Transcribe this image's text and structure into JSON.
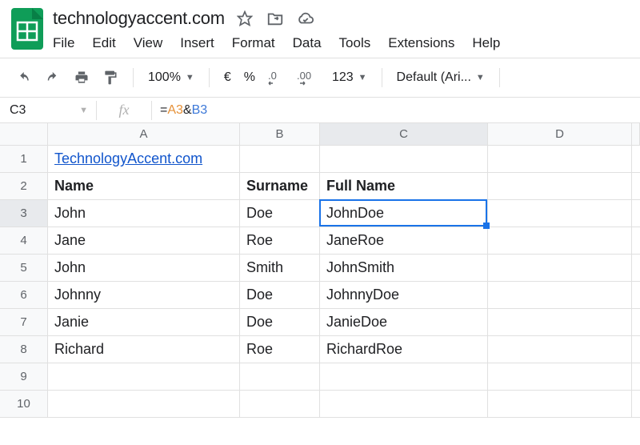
{
  "doc": {
    "title": "technologyaccent.com"
  },
  "menu": {
    "items": [
      "File",
      "Edit",
      "View",
      "Insert",
      "Format",
      "Data",
      "Tools",
      "Extensions",
      "Help"
    ]
  },
  "toolbar": {
    "zoom": "100%",
    "currency": "€",
    "percent": "%",
    "dec_dec": ".0",
    "dec_inc": ".00",
    "more_formats": "123",
    "font": "Default (Ari..."
  },
  "formula_bar": {
    "name_box": "C3",
    "formula_prefix": "=",
    "ref_a": "A3",
    "amp": "&",
    "ref_b": "B3"
  },
  "columns": [
    "A",
    "B",
    "C",
    "D",
    ""
  ],
  "rows": [
    {
      "n": "1",
      "cells": [
        "TechnologyAccent.com",
        "",
        "",
        "",
        ""
      ],
      "styles": [
        "link",
        "",
        "",
        "",
        ""
      ]
    },
    {
      "n": "2",
      "cells": [
        "Name",
        "Surname",
        "Full Name",
        "",
        ""
      ],
      "styles": [
        "bold",
        "bold",
        "bold",
        "",
        ""
      ]
    },
    {
      "n": "3",
      "cells": [
        "John",
        "Doe",
        "JohnDoe",
        "",
        ""
      ],
      "styles": [
        "",
        "",
        "",
        "",
        ""
      ]
    },
    {
      "n": "4",
      "cells": [
        "Jane",
        "Roe",
        "JaneRoe",
        "",
        ""
      ],
      "styles": [
        "",
        "",
        "",
        "",
        ""
      ]
    },
    {
      "n": "5",
      "cells": [
        "John",
        "Smith",
        "JohnSmith",
        "",
        ""
      ],
      "styles": [
        "",
        "",
        "",
        "",
        ""
      ]
    },
    {
      "n": "6",
      "cells": [
        "Johnny",
        "Doe",
        "JohnnyDoe",
        "",
        ""
      ],
      "styles": [
        "",
        "",
        "",
        "",
        ""
      ]
    },
    {
      "n": "7",
      "cells": [
        "Janie",
        "Doe",
        "JanieDoe",
        "",
        ""
      ],
      "styles": [
        "",
        "",
        "",
        "",
        ""
      ]
    },
    {
      "n": "8",
      "cells": [
        "Richard",
        "Roe",
        "RichardRoe",
        "",
        ""
      ],
      "styles": [
        "",
        "",
        "",
        "",
        ""
      ]
    },
    {
      "n": "9",
      "cells": [
        "",
        "",
        "",
        "",
        ""
      ],
      "styles": [
        "",
        "",
        "",
        "",
        ""
      ]
    },
    {
      "n": "10",
      "cells": [
        "",
        "",
        "",
        "",
        ""
      ],
      "styles": [
        "",
        "",
        "",
        "",
        ""
      ]
    }
  ],
  "active": {
    "row_index": 2,
    "col_index": 2
  },
  "chart_data": {
    "type": "table",
    "columns": [
      "Name",
      "Surname",
      "Full Name"
    ],
    "rows": [
      [
        "John",
        "Doe",
        "JohnDoe"
      ],
      [
        "Jane",
        "Roe",
        "JaneRoe"
      ],
      [
        "John",
        "Smith",
        "JohnSmith"
      ],
      [
        "Johnny",
        "Doe",
        "JohnnyDoe"
      ],
      [
        "Janie",
        "Doe",
        "JanieDoe"
      ],
      [
        "Richard",
        "Roe",
        "RichardRoe"
      ]
    ]
  }
}
